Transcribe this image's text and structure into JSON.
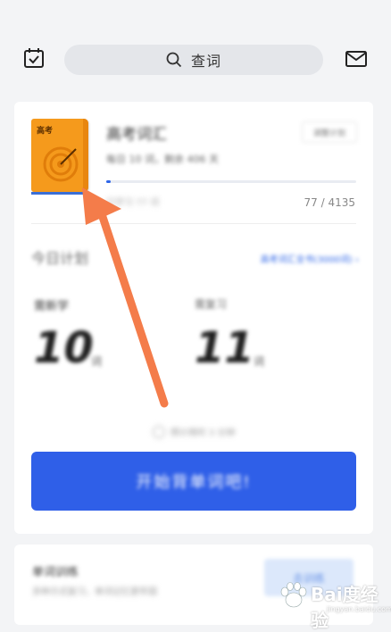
{
  "topbar": {
    "search_label": "查词",
    "icons": [
      "calendar-check-icon",
      "search-icon",
      "mail-icon"
    ]
  },
  "course": {
    "book_cover_text": "高考",
    "title": "高考词汇",
    "meta": "每日 10 词，剩余 406 天",
    "change_plan_label": "调整计划",
    "progress_caption": "已学习 77 词",
    "progress_count": "77 / 4135",
    "progress_fraction": 0.0186
  },
  "plan": {
    "today_label": "今日计划",
    "plan_link": "高考词汇全书(3000词) ›",
    "new_words_label": "需新学",
    "new_words_value": "10",
    "new_words_unit": "词",
    "review_label": "需复习",
    "review_value": "11",
    "review_unit": "词",
    "time_estimate": "预计用时 3 分钟"
  },
  "start_button_label": "开始背单词吧!",
  "training": {
    "title": "单词训练",
    "subtitle": "多种方式复习，单词记忆更牢固",
    "button_label": "去训练"
  },
  "watermark": {
    "text": "Bai度经验",
    "sub": "jingyan.baidu.com"
  },
  "colors": {
    "accent": "#2f5fe8",
    "book": "#f59a1c",
    "arrow": "#f47c4a"
  }
}
